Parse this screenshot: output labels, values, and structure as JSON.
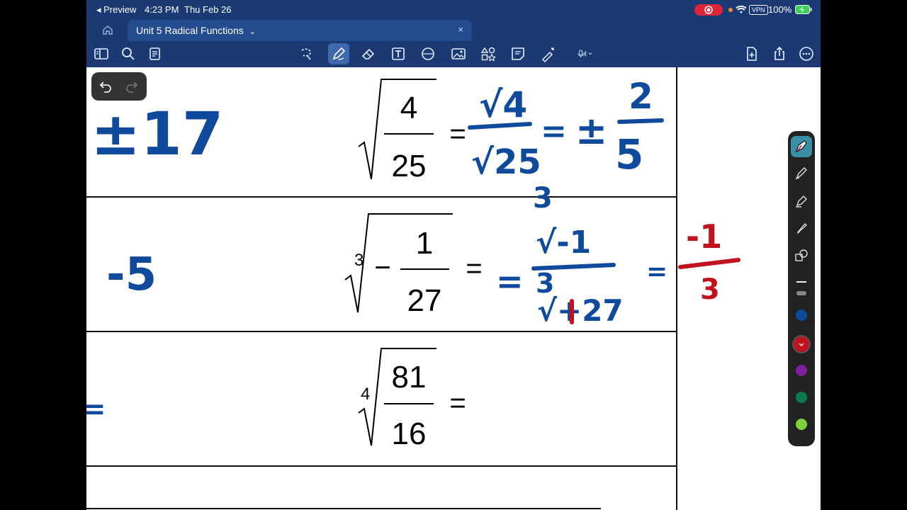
{
  "status_bar": {
    "back_app": "◂ Preview",
    "time": "4:23 PM",
    "date": "Thu Feb 26",
    "vpn": "VPN",
    "battery": "100%"
  },
  "tab": {
    "title": "Unit 5 Radical Functions",
    "chevron": "⌄",
    "close": "×"
  },
  "toolbar": {
    "left": [
      "sidebar-icon",
      "search-icon",
      "document-icon"
    ],
    "center": [
      "lasso-icon",
      "pen-icon",
      "eraser-icon",
      "text-icon",
      "shape-icon",
      "image-icon",
      "elements-icon",
      "sticky-note-icon",
      "laser-pointer-icon",
      "microphone-icon"
    ],
    "right": [
      "add-page-icon",
      "share-icon",
      "more-icon"
    ]
  },
  "worksheet": {
    "row1": {
      "expr_num": "4",
      "expr_den": "25",
      "equals": "="
    },
    "row2": {
      "index": "3",
      "minus": "−",
      "expr_num": "1",
      "expr_den": "27",
      "equals": "="
    },
    "row3": {
      "index": "4",
      "expr_num": "81",
      "expr_den": "16",
      "equals": "="
    }
  },
  "handwriting": {
    "left_margin": {
      "row1": "±17",
      "row2": "-5",
      "row3": "="
    },
    "row1_work": {
      "num": "√4",
      "den": "√25",
      "eq": "=",
      "pm": "±",
      "result_num": "2",
      "result_den": "5"
    },
    "row2_work": {
      "eq1": "=",
      "index_top": "3",
      "num": "√-1",
      "index_bot": "3",
      "den": "√+27",
      "eq2": "=",
      "result_num": "-1",
      "result_den": "3"
    }
  },
  "colors": {
    "topbar": "#1b3a73",
    "ink_blue": "#0f4a9c",
    "ink_red": "#c1121f",
    "palette_colors": [
      "#0f4a9c",
      "#c1121f",
      "#7a1f9e",
      "#0b7a4a",
      "#7ed13b"
    ]
  }
}
